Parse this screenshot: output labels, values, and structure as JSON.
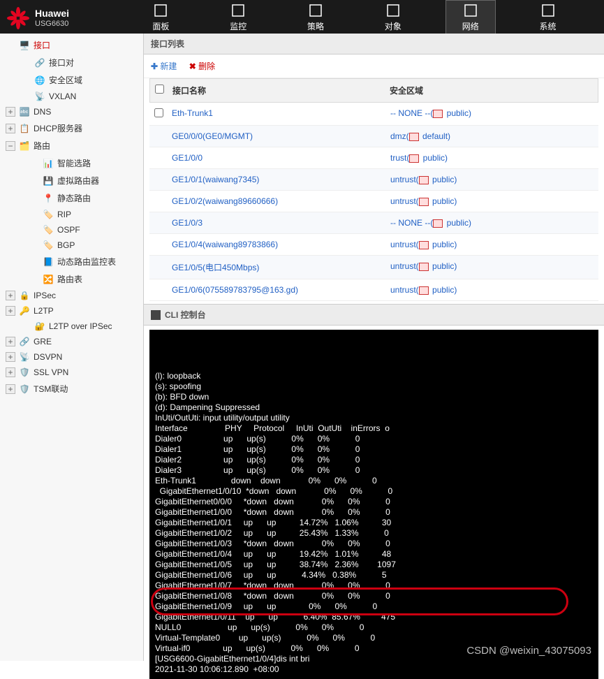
{
  "header": {
    "brand": "Huawei",
    "model": "USG6630",
    "nav": [
      {
        "label": "面板"
      },
      {
        "label": "监控"
      },
      {
        "label": "策略"
      },
      {
        "label": "对象"
      },
      {
        "label": "网络",
        "active": true
      },
      {
        "label": "系统"
      }
    ]
  },
  "sidebar": {
    "items": [
      {
        "label": "接口",
        "icon": "🖥️",
        "active": true,
        "toggle": ""
      },
      {
        "label": "接口对",
        "icon": "🔗",
        "sub": true
      },
      {
        "label": "安全区域",
        "icon": "🌐",
        "sub": true
      },
      {
        "label": "VXLAN",
        "icon": "📡",
        "sub": true
      },
      {
        "label": "DNS",
        "icon": "🔤",
        "toggle": "+"
      },
      {
        "label": "DHCP服务器",
        "icon": "📋",
        "toggle": "+"
      },
      {
        "label": "路由",
        "icon": "🗂️",
        "toggle": "−"
      },
      {
        "label": "智能选路",
        "icon": "📊",
        "sub2": true
      },
      {
        "label": "虚拟路由器",
        "icon": "💾",
        "sub2": true
      },
      {
        "label": "静态路由",
        "icon": "📍",
        "sub2": true
      },
      {
        "label": "RIP",
        "icon": "🏷️",
        "sub2": true
      },
      {
        "label": "OSPF",
        "icon": "🏷️",
        "sub2": true
      },
      {
        "label": "BGP",
        "icon": "🏷️",
        "sub2": true
      },
      {
        "label": "动态路由监控表",
        "icon": "📘",
        "sub2": true
      },
      {
        "label": "路由表",
        "icon": "🔀",
        "sub2": true
      },
      {
        "label": "IPSec",
        "icon": "🔒",
        "toggle": "+"
      },
      {
        "label": "L2TP",
        "icon": "🔑",
        "toggle": "+"
      },
      {
        "label": "L2TP over IPSec",
        "icon": "🔐",
        "sub": true
      },
      {
        "label": "GRE",
        "icon": "🔗",
        "toggle": "+"
      },
      {
        "label": "DSVPN",
        "icon": "📡",
        "toggle": "+"
      },
      {
        "label": "SSL VPN",
        "icon": "🛡️",
        "toggle": "+"
      },
      {
        "label": "TSM联动",
        "icon": "🛡️",
        "toggle": "+"
      }
    ]
  },
  "main": {
    "panel_title": "接口列表",
    "toolbar": {
      "add": "新建",
      "del": "删除"
    },
    "cols": {
      "name": "接口名称",
      "zone": "安全区域"
    },
    "rows": [
      {
        "name": "Eth-Trunk1",
        "zone": "-- NONE --(",
        "ztag": "public)",
        "chk": true
      },
      {
        "name": "GE0/0/0(GE0/MGMT)",
        "zone": "dmz(",
        "ztag": "default)"
      },
      {
        "name": "GE1/0/0",
        "zone": "trust(",
        "ztag": "public)"
      },
      {
        "name": "GE1/0/1(waiwang7345)",
        "zone": "untrust(",
        "ztag": "public)"
      },
      {
        "name": "GE1/0/2(waiwang89660666)",
        "zone": "untrust(",
        "ztag": "public)"
      },
      {
        "name": "GE1/0/3",
        "zone": "-- NONE --(",
        "ztag": "public)"
      },
      {
        "name": "GE1/0/4(waiwang89783866)",
        "zone": "untrust(",
        "ztag": "public)"
      },
      {
        "name": "GE1/0/5(电口450Mbps)",
        "zone": "untrust(",
        "ztag": "public)"
      },
      {
        "name": "GE1/0/6(07558978379​5@163.gd)",
        "zone": "untrust(",
        "ztag": "public)"
      }
    ]
  },
  "cli": {
    "title": "CLI 控制台",
    "legend": [
      "(l): loopback",
      "(s): spoofing",
      "(b): BFD down",
      "(d): Dampening Suppressed",
      "InUti/OutUti: input utility/output utility"
    ],
    "header": [
      "Interface",
      "PHY",
      "Protocol",
      "InUti",
      "OutUti",
      "inErrors",
      "o"
    ],
    "rows": [
      [
        "Dialer0",
        "up",
        "up(s)",
        "0%",
        "0%",
        "0"
      ],
      [
        "Dialer1",
        "up",
        "up(s)",
        "0%",
        "0%",
        "0"
      ],
      [
        "Dialer2",
        "up",
        "up(s)",
        "0%",
        "0%",
        "0"
      ],
      [
        "Dialer3",
        "up",
        "up(s)",
        "0%",
        "0%",
        "0"
      ],
      [
        "Eth-Trunk1",
        "down",
        "down",
        "0%",
        "0%",
        "0"
      ],
      [
        "  GigabitEthernet1/0/10",
        "*down",
        "down",
        "0%",
        "0%",
        "0"
      ],
      [
        "GigabitEthernet0/0/0",
        "*down",
        "down",
        "0%",
        "0%",
        "0"
      ],
      [
        "GigabitEthernet1/0/0",
        "*down",
        "down",
        "0%",
        "0%",
        "0"
      ],
      [
        "GigabitEthernet1/0/1",
        "up",
        "up",
        "14.72%",
        "1.06%",
        "30"
      ],
      [
        "GigabitEthernet1/0/2",
        "up",
        "up",
        "25.43%",
        "1.33%",
        "0"
      ],
      [
        "GigabitEthernet1/0/3",
        "*down",
        "down",
        "0%",
        "0%",
        "0"
      ],
      [
        "GigabitEthernet1/0/4",
        "up",
        "up",
        "19.42%",
        "1.01%",
        "48"
      ],
      [
        "GigabitEthernet1/0/5",
        "up",
        "up",
        "38.74%",
        "2.36%",
        "1097"
      ],
      [
        "GigabitEthernet1/0/6",
        "up",
        "up",
        "4.34%",
        "0.38%",
        "5"
      ],
      [
        "GigabitEthernet1/0/7",
        "*down",
        "down",
        "0%",
        "0%",
        "0"
      ],
      [
        "GigabitEthernet1/0/8",
        "*down",
        "down",
        "0%",
        "0%",
        "0"
      ],
      [
        "GigabitEthernet1/0/9",
        "up",
        "up",
        "0%",
        "0%",
        "0"
      ],
      [
        "GigabitEthernet1/0/11",
        "up",
        "up",
        "6.40%",
        "85.67%",
        "475"
      ],
      [
        "NULL0",
        "up",
        "up(s)",
        "0%",
        "0%",
        "0"
      ],
      [
        "Virtual-Template0",
        "up",
        "up(s)",
        "0%",
        "0%",
        "0"
      ],
      [
        "Virtual-if0",
        "up",
        "up(s)",
        "0%",
        "0%",
        "0"
      ]
    ],
    "footer": [
      "[USG6600-GigabitEthernet1/0/4]dis int bri",
      "2021-11-30 10:06:12.890  +08:00"
    ]
  },
  "watermark": "CSDN @weixin_43075093"
}
